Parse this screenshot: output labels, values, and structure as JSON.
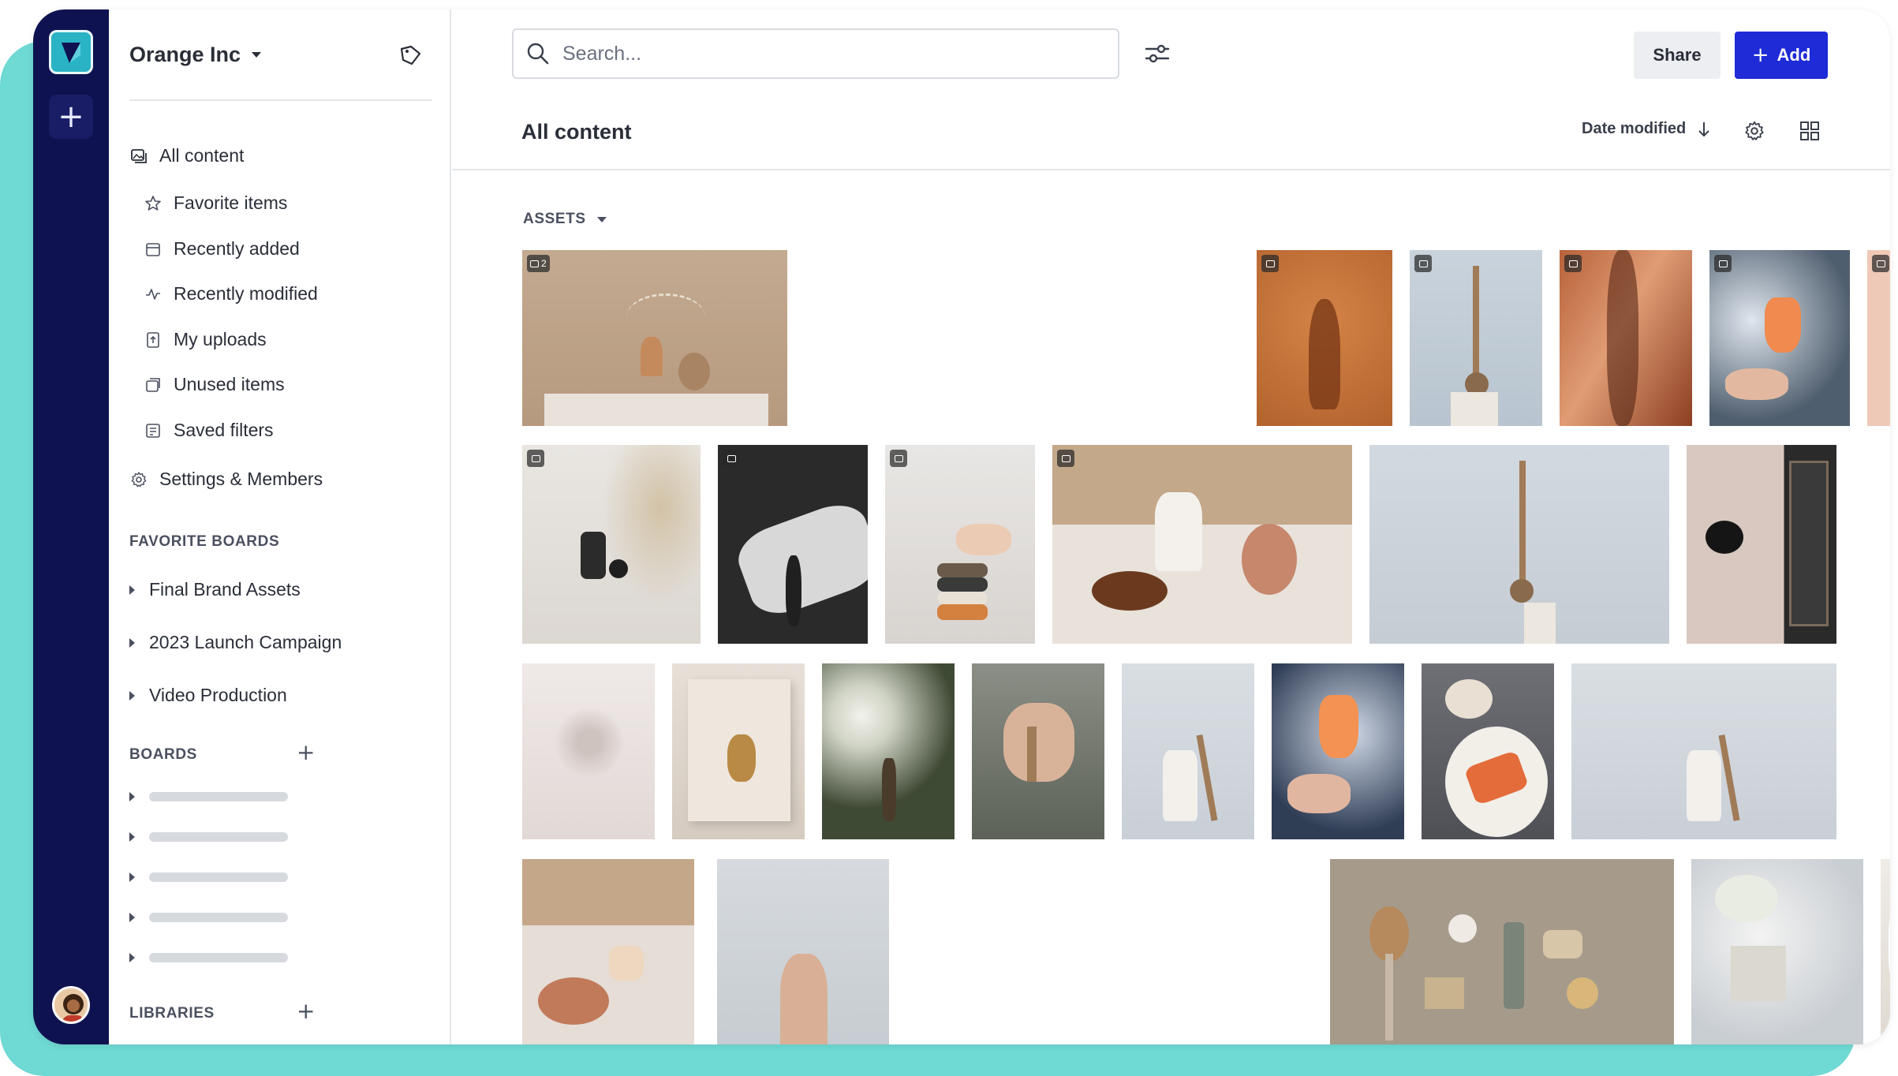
{
  "sidebar": {
    "org_name": "Orange Inc",
    "nav": [
      {
        "label": "All content",
        "icon": "image-stack-icon"
      },
      {
        "label": "Favorite items",
        "icon": "star-icon"
      },
      {
        "label": "Recently added",
        "icon": "calendar-icon"
      },
      {
        "label": "Recently modified",
        "icon": "activity-icon"
      },
      {
        "label": "My uploads",
        "icon": "upload-icon"
      },
      {
        "label": "Unused items",
        "icon": "unused-icon"
      },
      {
        "label": "Saved filters",
        "icon": "saved-filter-icon"
      },
      {
        "label": "Settings & Members",
        "icon": "gear-icon"
      }
    ],
    "favorite_boards_heading": "FAVORITE BOARDS",
    "favorite_boards": [
      "Final Brand Assets",
      "2023 Launch Campaign",
      "Video Production"
    ],
    "boards_heading": "BOARDS",
    "libraries_heading": "LIBRARIES"
  },
  "header": {
    "search_placeholder": "Search...",
    "share_label": "Share",
    "add_label": "Add"
  },
  "content": {
    "title": "All content",
    "sort_label": "Date modified",
    "assets_heading": "ASSETS",
    "comment_count": "2"
  },
  "colors": {
    "rail": "#0f1250",
    "accent": "#1e2bd6",
    "teal": "#6fd9d4"
  }
}
